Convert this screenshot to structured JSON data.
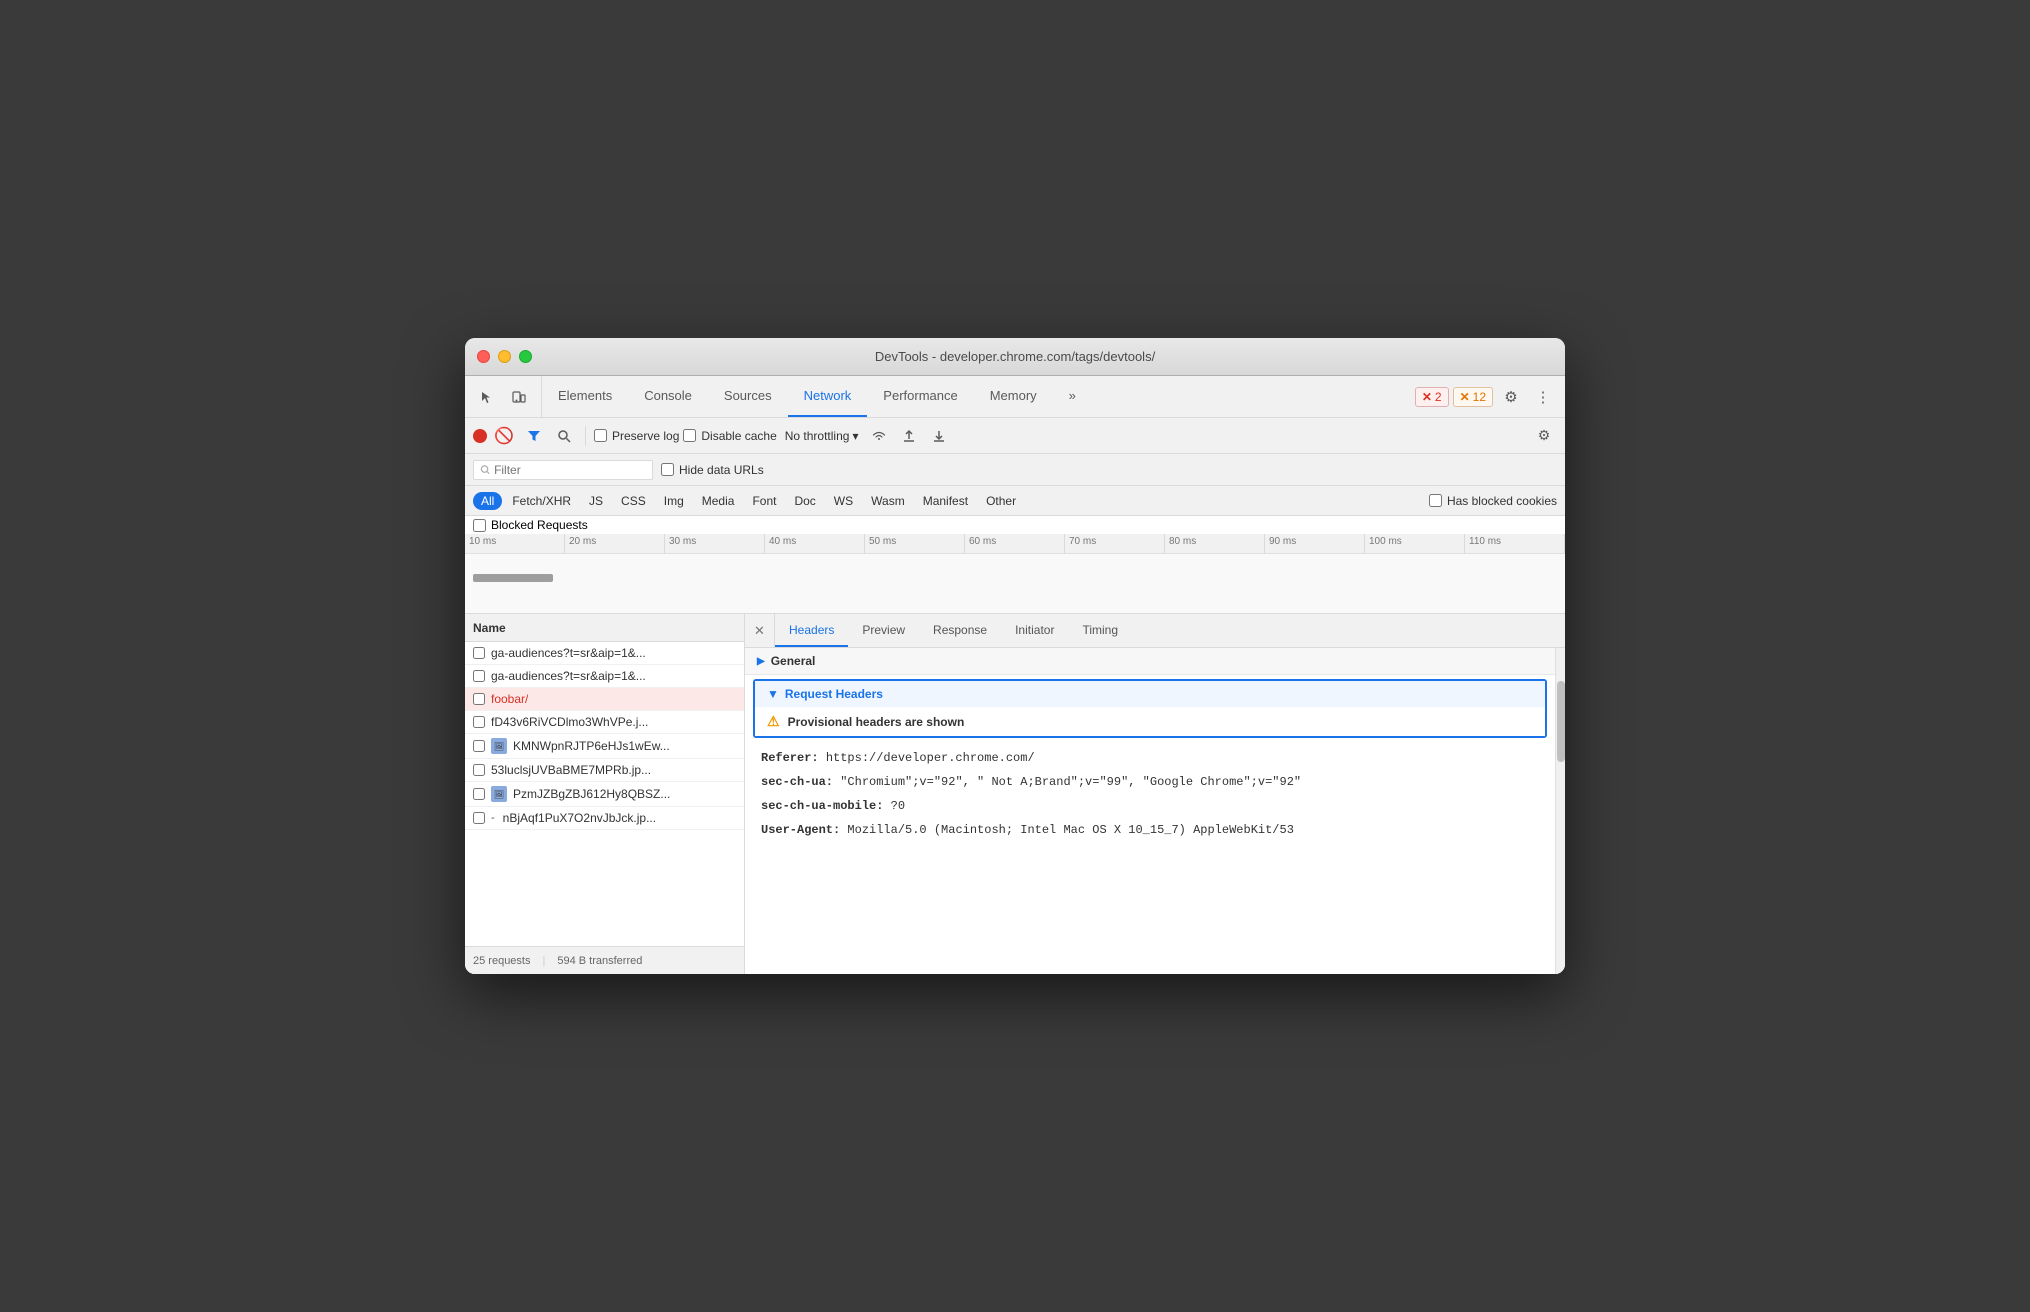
{
  "window": {
    "title": "DevTools - developer.chrome.com/tags/devtools/"
  },
  "tabs": [
    {
      "id": "elements",
      "label": "Elements",
      "active": false
    },
    {
      "id": "console",
      "label": "Console",
      "active": false
    },
    {
      "id": "sources",
      "label": "Sources",
      "active": false
    },
    {
      "id": "network",
      "label": "Network",
      "active": true
    },
    {
      "id": "performance",
      "label": "Performance",
      "active": false
    },
    {
      "id": "memory",
      "label": "Memory",
      "active": false
    }
  ],
  "toolbar": {
    "preserve_log": "Preserve log",
    "disable_cache": "Disable cache",
    "no_throttling": "No throttling",
    "hide_data_urls": "Hide data URLs",
    "filter_placeholder": "Filter"
  },
  "type_filters": [
    {
      "id": "all",
      "label": "All",
      "active": true
    },
    {
      "id": "fetch-xhr",
      "label": "Fetch/XHR",
      "active": false
    },
    {
      "id": "js",
      "label": "JS",
      "active": false
    },
    {
      "id": "css",
      "label": "CSS",
      "active": false
    },
    {
      "id": "img",
      "label": "Img",
      "active": false
    },
    {
      "id": "media",
      "label": "Media",
      "active": false
    },
    {
      "id": "font",
      "label": "Font",
      "active": false
    },
    {
      "id": "doc",
      "label": "Doc",
      "active": false
    },
    {
      "id": "ws",
      "label": "WS",
      "active": false
    },
    {
      "id": "wasm",
      "label": "Wasm",
      "active": false
    },
    {
      "id": "manifest",
      "label": "Manifest",
      "active": false
    },
    {
      "id": "other",
      "label": "Other",
      "active": false
    }
  ],
  "has_blocked_cookies": "Has blocked cookies",
  "blocked_requests": "Blocked Requests",
  "ruler_ticks": [
    "10 ms",
    "20 ms",
    "30 ms",
    "40 ms",
    "50 ms",
    "60 ms",
    "70 ms",
    "80 ms",
    "90 ms",
    "100 ms",
    "110 ms"
  ],
  "file_list": {
    "header": "Name",
    "items": [
      {
        "id": "ga-audiences-1",
        "name": "ga-audiences?t=sr&aip=1&...",
        "selected": false,
        "has_thumb": false
      },
      {
        "id": "ga-audiences-2",
        "name": "ga-audiences?t=sr&aip=1&...",
        "selected": false,
        "has_thumb": false
      },
      {
        "id": "foobar",
        "name": "foobar/",
        "selected": true,
        "has_thumb": false
      },
      {
        "id": "fd43v6",
        "name": "fD43v6RiVCDlmo3WhVPe.j...",
        "selected": false,
        "has_thumb": false
      },
      {
        "id": "kmnwpn",
        "name": "KMNWpnRJTP6eHJs1wEw...",
        "selected": false,
        "has_thumb": true
      },
      {
        "id": "53lucls",
        "name": "53luclsjUVBaBME7MPRb.jp...",
        "selected": false,
        "has_thumb": false
      },
      {
        "id": "pzmjzb",
        "name": "PzmJZBgZBJ612Hy8QBSZ...",
        "selected": false,
        "has_thumb": true
      },
      {
        "id": "nbjaqf",
        "name": "nBjAqf1PuX7O2nvJbJck.jp...",
        "selected": false,
        "has_thumb": false
      }
    ],
    "footer": {
      "requests": "25 requests",
      "transferred": "594 B transferred"
    }
  },
  "detail_tabs": [
    {
      "id": "headers",
      "label": "Headers",
      "active": true
    },
    {
      "id": "preview",
      "label": "Preview",
      "active": false
    },
    {
      "id": "response",
      "label": "Response",
      "active": false
    },
    {
      "id": "initiator",
      "label": "Initiator",
      "active": false
    },
    {
      "id": "timing",
      "label": "Timing",
      "active": false
    }
  ],
  "general_section": {
    "label": "General",
    "expanded": true
  },
  "request_headers_section": {
    "label": "Request Headers",
    "warning": "Provisional headers are shown",
    "headers": [
      {
        "key": "Referer:",
        "value": "https://developer.chrome.com/"
      },
      {
        "key": "sec-ch-ua:",
        "value": "\"Chromium\";v=\"92\", \" Not A;Brand\";v=\"99\", \"Google Chrome\";v=\"92\""
      },
      {
        "key": "sec-ch-ua-mobile:",
        "value": "?0"
      },
      {
        "key": "User-Agent:",
        "value": "Mozilla/5.0 (Macintosh; Intel Mac OS X 10_15_7) AppleWebKit/53"
      }
    ]
  },
  "badges": {
    "errors": "2",
    "warnings": "12"
  }
}
